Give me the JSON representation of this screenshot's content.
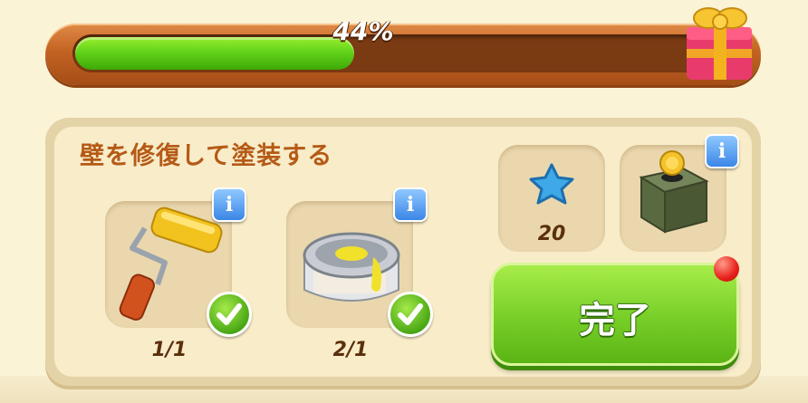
{
  "progress": {
    "percent_label": "44%",
    "fraction": 0.44
  },
  "task": {
    "title": "壁を修復して塗装する",
    "items": [
      {
        "icon": "paint-roller-icon",
        "count": "1/1",
        "completed": true
      },
      {
        "icon": "paint-can-icon",
        "count": "2/1",
        "completed": true
      }
    ]
  },
  "rewards": [
    {
      "icon": "blue-star-icon",
      "amount": "20"
    },
    {
      "icon": "coin-box-icon"
    }
  ],
  "done_button": {
    "label": "完了"
  },
  "colors": {
    "progress_fill": "#62d31a",
    "frame": "#c36322",
    "title": "#b55a16",
    "done_button": "#7bd12a",
    "info": "#3b86e6",
    "notification": "#e8201a"
  }
}
